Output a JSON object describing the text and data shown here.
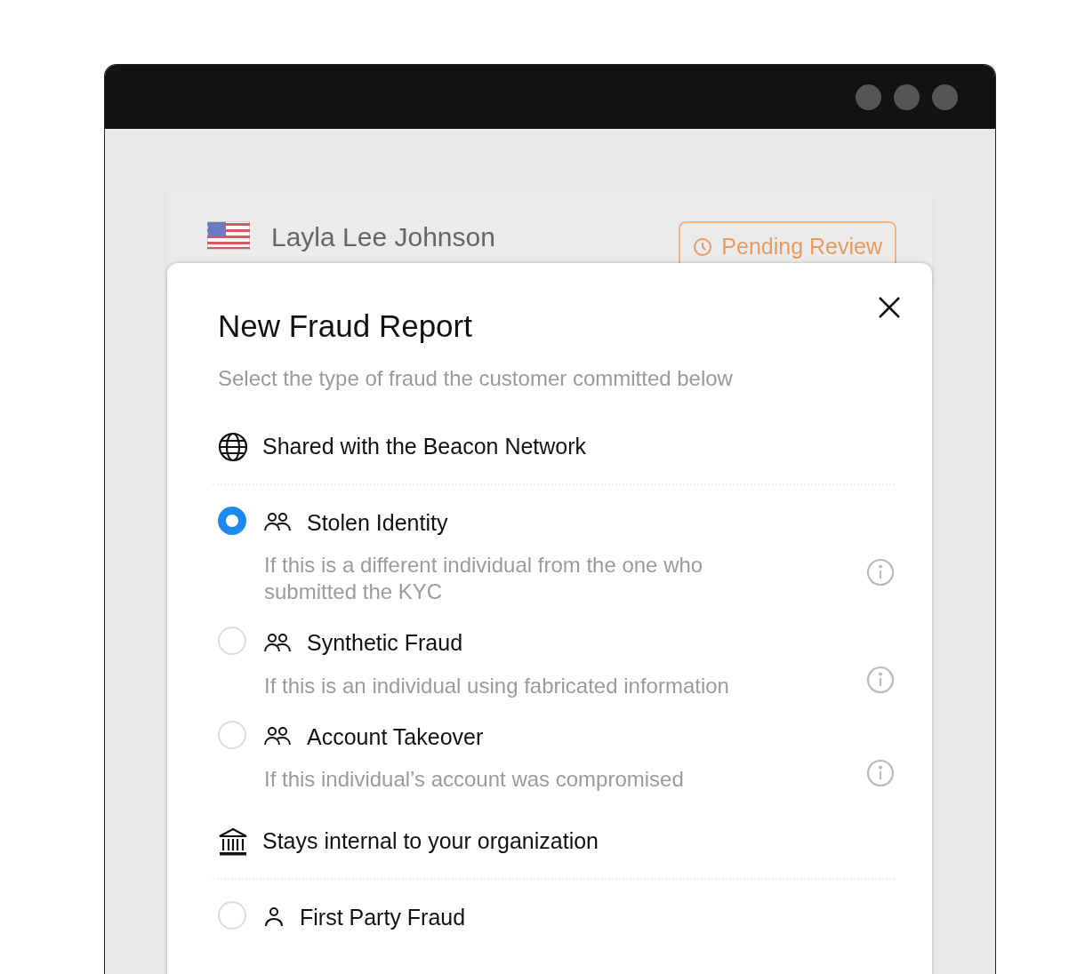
{
  "header": {
    "name": "Layla Lee Johnson",
    "status": "Pending Review"
  },
  "modal": {
    "title": "New Fraud Report",
    "subtitle": "Select the type of fraud the customer committed below",
    "sections": [
      {
        "heading": "Shared with the Beacon Network",
        "kind": "shared",
        "options": [
          {
            "label": "Stolen Identity",
            "description": "If this is a different individual from the one who submitted the KYC",
            "selected": true,
            "kind": "group"
          },
          {
            "label": "Synthetic Fraud",
            "description": "If this is an individual using fabricated information",
            "selected": false,
            "kind": "group"
          },
          {
            "label": "Account Takeover",
            "description": "If this individual’s account was compromised",
            "selected": false,
            "kind": "group"
          }
        ]
      },
      {
        "heading": "Stays internal to your organization",
        "kind": "internal",
        "options": [
          {
            "label": "First Party Fraud",
            "selected": false,
            "kind": "single"
          }
        ]
      }
    ]
  }
}
